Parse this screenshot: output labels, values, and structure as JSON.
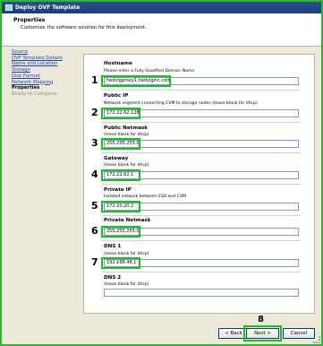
{
  "window": {
    "title": "Deploy OVF Template"
  },
  "header": {
    "title": "Properties",
    "subtitle": "Customize the software solution for this deployment."
  },
  "nav": {
    "items": [
      {
        "label": "Source",
        "state": "link"
      },
      {
        "label": "OVF Template Details",
        "state": "link"
      },
      {
        "label": "Name and Location",
        "state": "link"
      },
      {
        "label": "Storage",
        "state": "link"
      },
      {
        "label": "Disk Format",
        "state": "link"
      },
      {
        "label": "Network Mapping",
        "state": "link"
      },
      {
        "label": "Properties",
        "state": "current"
      },
      {
        "label": "Ready to Complete",
        "state": "disabled"
      }
    ]
  },
  "fields": {
    "hostname": {
      "label": "Hostname",
      "desc": "Please enter a Fully Qualified Domain Name",
      "value": "hedvigproxy1.hedviginc.com",
      "step": "1"
    },
    "public_ip": {
      "label": "Public IP",
      "desc": "Network segment connecting CVM to storage nodes (leave blank for dhcp)",
      "value": "172.22.62.128",
      "step": "2"
    },
    "public_netmask": {
      "label": "Public Netmask",
      "desc": "(leave blank for dhcp)",
      "value": "255.255.255.0",
      "step": "3"
    },
    "gateway": {
      "label": "Gateway",
      "desc": "(leave blank for dhcp)",
      "value": "172.22.62.1",
      "step": "4"
    },
    "private_ip": {
      "label": "Private IP",
      "desc": "Isolated network between ESX and CVM",
      "value": "172.20.20.2",
      "step": "5"
    },
    "private_netmask": {
      "label": "Private Netmask",
      "desc": "",
      "value": "255.255.255.0",
      "step": "6"
    },
    "dns1": {
      "label": "DNS 1",
      "desc": "(leave blank for dhcp)",
      "value": "192.168.48.1",
      "step": "7"
    },
    "dns2": {
      "label": "DNS 2",
      "desc": "(leave blank for dhcp)",
      "value": ""
    }
  },
  "buttons": {
    "back": "< Back",
    "next": "Next >",
    "cancel": "Cancel",
    "next_step": "8"
  },
  "colors": {
    "highlight": "#16c21b",
    "titlebar": "#1c3f7a"
  }
}
